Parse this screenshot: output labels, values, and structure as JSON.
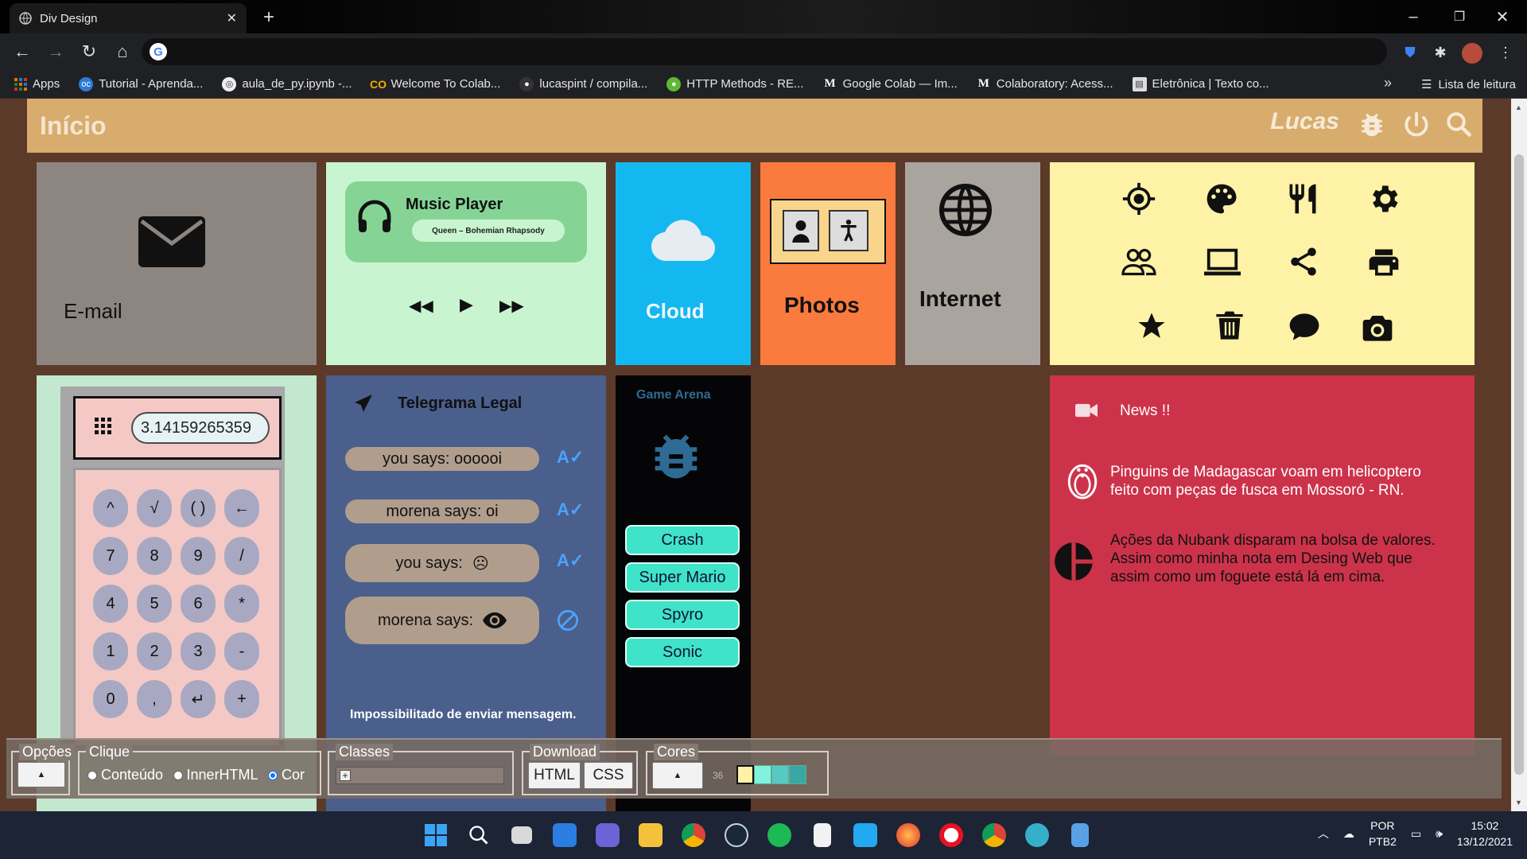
{
  "browser": {
    "tab_title": "Div Design",
    "new_tab": "+",
    "omnibox_logo": "G",
    "bookmarks": [
      {
        "label": "Apps",
        "icon": "apps-grid-icon"
      },
      {
        "label": "Tutorial - Aprenda...",
        "icon": "oc-icon"
      },
      {
        "label": "aula_de_py.ipynb -...",
        "icon": "jupyter-icon"
      },
      {
        "label": "Welcome To Colab...",
        "icon": "colab-icon"
      },
      {
        "label": "lucaspint / compila...",
        "icon": "github-icon"
      },
      {
        "label": "HTTP Methods - RE...",
        "icon": "rest-icon"
      },
      {
        "label": "Google Colab — Im...",
        "icon": "medium-icon"
      },
      {
        "label": "Colaboratory: Acess...",
        "icon": "medium-icon"
      },
      {
        "label": "Eletrônica | Texto co...",
        "icon": "doc-icon"
      }
    ],
    "more": "»",
    "reading_list": "Lista de leitura"
  },
  "header": {
    "home": "Início",
    "user": "Lucas"
  },
  "cards": {
    "email": {
      "label": "E-mail",
      "bg": "#8c8580"
    },
    "music": {
      "title": "Music Player",
      "track": "Queen – Bohemian Rhapsody",
      "bg": "#c8f5cf"
    },
    "cloud": {
      "label": "Cloud",
      "bg": "#14b8f0"
    },
    "photos": {
      "label": "Photos",
      "bg": "#fb7a3e"
    },
    "internet": {
      "label": "Internet",
      "bg": "#aaa49f"
    },
    "icons": {
      "bg": "#fdf2a6",
      "items": [
        "gps-icon",
        "palette-icon",
        "restaurant-icon",
        "gear-icon",
        "people-icon",
        "laptop-icon",
        "share-icon",
        "printer-icon",
        "star-icon",
        "trash-icon",
        "chat-icon",
        "camera-icon"
      ]
    },
    "calculator": {
      "display": "3.14159265359",
      "keys": [
        "^",
        "√",
        "( )",
        "←",
        "7",
        "8",
        "9",
        "/",
        "4",
        "5",
        "6",
        "*",
        "1",
        "2",
        "3",
        "-",
        "0",
        ",",
        "↵",
        "+"
      ]
    },
    "telegram": {
      "title": "Telegrama Legal",
      "messages": [
        {
          "text": "you says: oooooi"
        },
        {
          "text": "morena says: oi"
        },
        {
          "text": "you says:",
          "emoji": "☹"
        },
        {
          "text": "morena says:"
        }
      ],
      "footer": "Impossibilitado de enviar mensagem.",
      "bg": "#4a5f8c"
    },
    "game": {
      "title": "Game Arena",
      "games": [
        "Crash",
        "Super Mario",
        "Spyro",
        "Sonic"
      ]
    },
    "news": {
      "title": "News !!",
      "items": [
        "Pinguins de Madagascar voam em helicoptero feito com peças de fusca em Mossoró - RN.",
        "Ações da Nubank disparam na bolsa de valores. Assim como minha nota em Desing Web que assim como um foguete está lá em cima."
      ],
      "bg": "#cc334a"
    }
  },
  "devpanel": {
    "opcoes": "Opções",
    "clique": "Clique",
    "radios": [
      "Conteúdo",
      "InnerHTML",
      "Cor"
    ],
    "classes": "Classes",
    "download": "Download",
    "html": "HTML",
    "css": "CSS",
    "cores": "Cores",
    "cores_count": "36",
    "swatches": [
      "#fdf2a6",
      "#7ff3df",
      "#56c9c5",
      "#39a8a5"
    ]
  },
  "taskbar": {
    "lang": "POR",
    "layout": "PTB2",
    "time": "15:02",
    "date": "13/12/2021"
  }
}
